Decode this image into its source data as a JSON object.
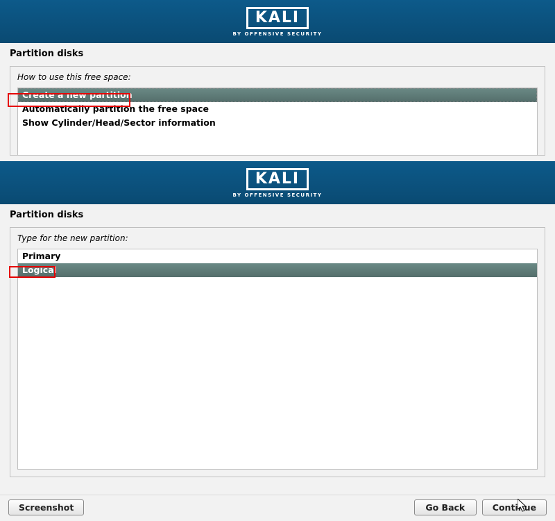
{
  "branding": {
    "logo_text": "KALI",
    "logo_sub": "BY OFFENSIVE SECURITY"
  },
  "screen1": {
    "title": "Partition disks",
    "prompt": "How to use this free space:",
    "options": [
      "Create a new partition",
      "Automatically partition the free space",
      "Show Cylinder/Head/Sector information"
    ],
    "selected_index": 0
  },
  "screen2": {
    "title": "Partition disks",
    "prompt": "Type for the new partition:",
    "options": [
      "Primary",
      "Logical"
    ],
    "selected_index": 1
  },
  "footer": {
    "screenshot_label": "Screenshot",
    "go_back_label": "Go Back",
    "continue_label": "Continue"
  }
}
